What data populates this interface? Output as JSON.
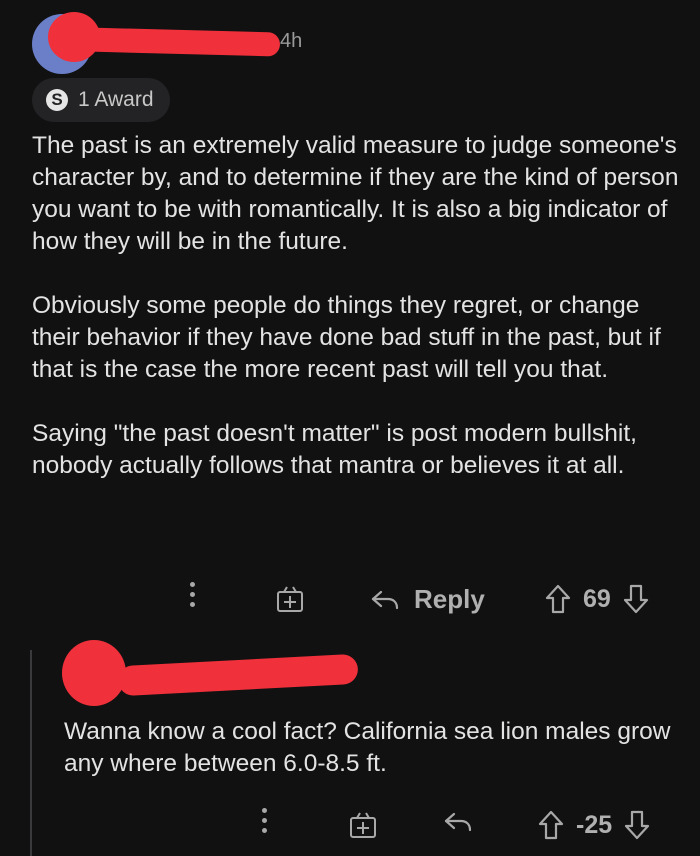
{
  "comment1": {
    "timestamp": "4h",
    "award_label": "1 Award",
    "paragraphs": [
      "The past is an extremely valid measure to judge someone's character by, and to determine if they are the kind of person you want to be with romantically. It is also a big indicator of how they will be in the future.",
      "Obviously some people do things they regret, or change their behavior if they have done bad stuff in the past, but if that is the case the more recent past will tell you that.",
      "Saying \"the past doesn't matter\" is post modern bullshit, nobody actually follows that mantra or believes it at all."
    ],
    "reply_label": "Reply",
    "score": "69"
  },
  "comment2": {
    "text": "Wanna know a cool fact? California sea lion males grow any where between 6.0-8.5 ft.",
    "score": "-25"
  },
  "icons": {
    "award": "silver-award-icon",
    "more": "more-vertical-icon",
    "gift": "gift-award-icon",
    "reply": "reply-arrow-icon",
    "upvote": "upvote-arrow-icon",
    "downvote": "downvote-arrow-icon"
  },
  "colors": {
    "background": "#111112",
    "text": "#e3e3e3",
    "muted": "#a8a8a8",
    "redaction": "#f0303a",
    "avatar": "#6a7fc8"
  }
}
